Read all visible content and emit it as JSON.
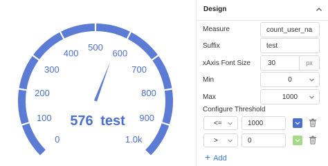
{
  "gauge": {
    "value_text": "576",
    "suffix_text": "test",
    "ticks": [
      "0",
      "100",
      "200",
      "300",
      "400",
      "500",
      "600",
      "700",
      "800",
      "900",
      "1.0k"
    ],
    "min": 0,
    "max": 1000,
    "value": 576,
    "color": "#5b7bd5"
  },
  "design": {
    "title": "Design",
    "measure_label": "Measure",
    "measure_value": "count_user_na",
    "suffix_label": "Suffix",
    "suffix_value": "test",
    "xaxis_font_label": "xAxis Font Size",
    "xaxis_font_value": "30",
    "xaxis_font_unit": "px",
    "min_label": "Min",
    "min_value": "0",
    "max_label": "Max",
    "max_value": "1000",
    "threshold_label": "Configure Threshold",
    "thresholds": [
      {
        "operator": "<=",
        "value": "1000",
        "color": "#4a6fcf"
      },
      {
        "operator": ">",
        "value": "0",
        "color": "#a7d98b"
      }
    ],
    "add_label": "Add"
  }
}
